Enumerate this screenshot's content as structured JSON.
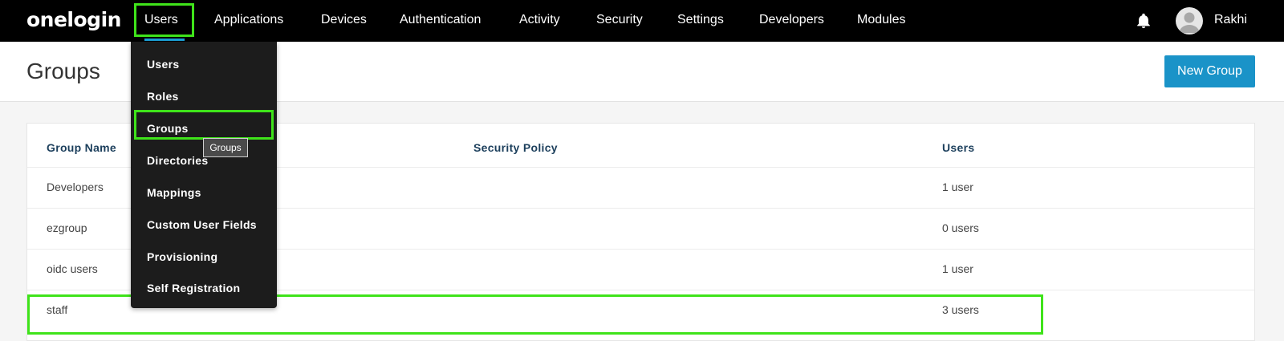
{
  "brand": {
    "logo_text": "onelogin"
  },
  "nav": {
    "items": [
      {
        "label": "Users"
      },
      {
        "label": "Applications"
      },
      {
        "label": "Devices"
      },
      {
        "label": "Authentication"
      },
      {
        "label": "Activity"
      },
      {
        "label": "Security"
      },
      {
        "label": "Settings"
      },
      {
        "label": "Developers"
      },
      {
        "label": "Modules"
      }
    ],
    "active_index": 0
  },
  "user": {
    "name": "Rakhi",
    "avatar_icon": "user-avatar-icon",
    "notification_icon": "bell-icon"
  },
  "page": {
    "title": "Groups",
    "new_group_label": "New Group"
  },
  "table": {
    "headers": {
      "group_name": "Group Name",
      "security_policy": "Security Policy",
      "users": "Users"
    },
    "rows": [
      {
        "name": "Developers",
        "policy": "",
        "users": "1 user"
      },
      {
        "name": "ezgroup",
        "policy": "",
        "users": "0 users"
      },
      {
        "name": "oidc users",
        "policy": "",
        "users": "1 user"
      },
      {
        "name": "staff",
        "policy": "",
        "users": "3 users"
      }
    ]
  },
  "users_menu": {
    "items": [
      {
        "label": "Users"
      },
      {
        "label": "Roles"
      },
      {
        "label": "Groups"
      },
      {
        "label": "Directories"
      },
      {
        "label": "Mappings"
      },
      {
        "label": "Custom User Fields"
      },
      {
        "label": "Provisioning"
      },
      {
        "label": "Self Registration"
      }
    ],
    "highlighted_index": 2,
    "tooltip": "Groups"
  },
  "colors": {
    "topbar": "#000000",
    "accent": "#1a93c8",
    "highlight": "#3fe31a",
    "dropdown": "#1c1c1c",
    "header_text": "#1c3f5c"
  }
}
